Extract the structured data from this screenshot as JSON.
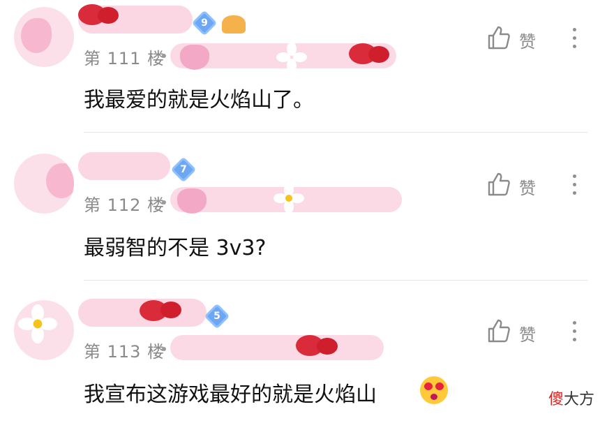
{
  "colors": {
    "like": "#8a8a8a",
    "badge": "#6da6f2",
    "watermark_accent": "#e02424"
  },
  "comments": [
    {
      "level": "9",
      "floor": "第 111 楼",
      "like_label": "赞",
      "text": "我最爱的就是火焰山了。"
    },
    {
      "level": "7",
      "floor": "第 112 楼",
      "like_label": "赞",
      "text": "最弱智的不是 3v3?"
    },
    {
      "level": "5",
      "floor": "第 113 楼",
      "like_label": "赞",
      "text": "我宣布这游戏最好的就是火焰山"
    }
  ],
  "watermark": {
    "accent": "傻",
    "rest": "大方"
  },
  "icons": [
    "thumbs-up-icon",
    "more-vertical-icon",
    "heart-eyes-emoji-icon",
    "level-badge-icon"
  ]
}
